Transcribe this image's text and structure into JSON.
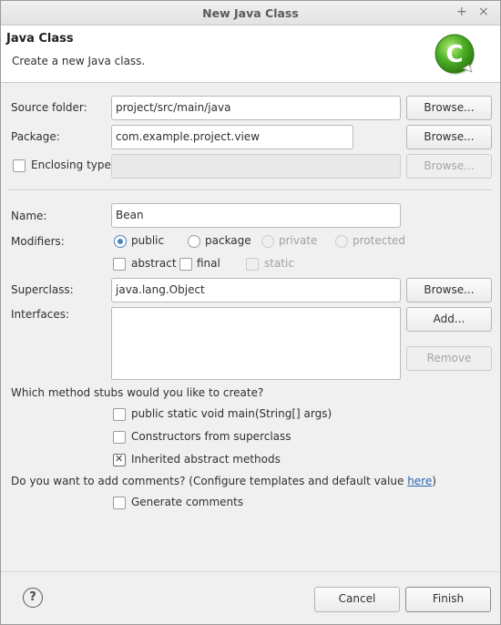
{
  "window": {
    "title": "New Java Class",
    "pin_glyph": "+",
    "close_glyph": "×"
  },
  "header": {
    "title": "Java Class",
    "description": "Create a new Java class.",
    "icon_letter": "C",
    "icon": "class-wizard-icon"
  },
  "form": {
    "source_folder": {
      "label": "Source folder:",
      "value": "project/src/main/java",
      "browse": "Browse..."
    },
    "package": {
      "label": "Package:",
      "value": "com.example.project.view",
      "browse": "Browse..."
    },
    "enclosing_type": {
      "label": "Enclosing type:",
      "value": "",
      "browse": "Browse...",
      "checked": false
    },
    "name": {
      "label": "Name:",
      "value": "Bean"
    },
    "modifiers": {
      "label": "Modifiers:",
      "access": [
        {
          "label": "public",
          "selected": true,
          "enabled": true
        },
        {
          "label": "package",
          "selected": false,
          "enabled": true
        },
        {
          "label": "private",
          "selected": false,
          "enabled": false
        },
        {
          "label": "protected",
          "selected": false,
          "enabled": false
        }
      ],
      "abstract": {
        "label": "abstract",
        "checked": false
      },
      "final": {
        "label": "final",
        "checked": false
      },
      "static": {
        "label": "static",
        "checked": false,
        "enabled": false
      }
    },
    "superclass": {
      "label": "Superclass:",
      "value": "java.lang.Object",
      "browse": "Browse..."
    },
    "interfaces": {
      "label": "Interfaces:",
      "add": "Add...",
      "remove": "Remove",
      "items": []
    },
    "method_stubs": {
      "question": "Which method stubs would you like to create?",
      "options": [
        {
          "label": "public static void main(String[] args)",
          "checked": false
        },
        {
          "label": "Constructors from superclass",
          "checked": false
        },
        {
          "label": "Inherited abstract methods",
          "checked": true
        }
      ]
    },
    "comments": {
      "question_prefix": "Do you want to add comments? (Configure templates and default value ",
      "link": "here",
      "question_suffix": ")",
      "generate": {
        "label": "Generate comments",
        "checked": false
      }
    }
  },
  "footer": {
    "help_glyph": "?",
    "cancel": "Cancel",
    "finish": "Finish"
  },
  "colors": {
    "icon_green": "#4caf25",
    "radio_accent": "#4a84bf",
    "link": "#2a6ab0"
  }
}
